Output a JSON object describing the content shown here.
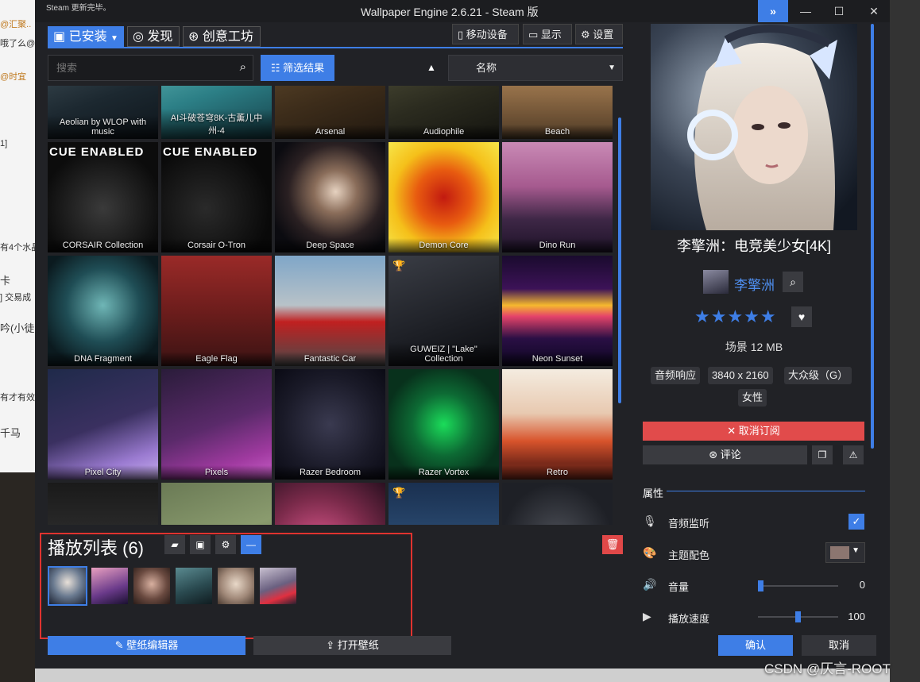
{
  "background": {
    "left_texts": [
      "@汇聚..",
      "哦了么@",
      "@时宜",
      "1]",
      "有4个水晶",
      "卡",
      "] 交易成",
      "吟(小徒",
      "有才有效",
      "千马"
    ]
  },
  "window": {
    "title": "Wallpaper Engine 2.6.21 - Steam 版",
    "steam_note": "Steam 更新完毕。",
    "controls": [
      "»",
      "—",
      "☐",
      "✕"
    ]
  },
  "tabs": [
    {
      "label": "已安装",
      "icon": "save-icon",
      "active": true
    },
    {
      "label": "发现",
      "icon": "compass-icon",
      "active": false
    },
    {
      "label": "创意工坊",
      "icon": "steam-icon",
      "active": false
    }
  ],
  "toolbar": {
    "mobile": "移动设备",
    "display": "显示",
    "settings": "设置"
  },
  "search": {
    "placeholder": "搜索"
  },
  "filter": {
    "label": "筛选结果"
  },
  "sort": {
    "direction": "▲",
    "value": "名称"
  },
  "wallpapers": [
    {
      "label": "Aeolian by WLOP with music",
      "bg": "linear-gradient(160deg,#4a5a62,#1c2830 60%,#0e151b)"
    },
    {
      "label": "AI斗破苍穹8K-古薰儿中州-4",
      "bg": "linear-gradient(160deg,#6fc3c0,#2c7f86 55%,#16414a)"
    },
    {
      "label": "Arsenal",
      "bg": "linear-gradient(160deg,#6a5131,#3c2c1a 60%,#221910)"
    },
    {
      "label": "Audiophile",
      "bg": "linear-gradient(160deg,#5a5a40,#2b2b1f 60%,#151510)"
    },
    {
      "label": "Beach",
      "bg": "linear-gradient(180deg,#d4a66a,#8d6a45 60%,#4f3a25)"
    },
    {
      "label": "CORSAIR Collection",
      "bg": "radial-gradient(circle at 50% 60%,#3a3a3a,#0c0c0c 70%)",
      "badge": "CUE ENABLED"
    },
    {
      "label": "Corsair O-Tron",
      "bg": "radial-gradient(circle at 40% 60%,#2a2a2a,#090909 70%)",
      "badge": "CUE ENABLED"
    },
    {
      "label": "Deep Space",
      "bg": "radial-gradient(ellipse at 55% 45%,#e6d2c0,#8a6d5a 25%,#2a2022 55%,#0b0b10 80%)"
    },
    {
      "label": "Demon Core",
      "bg": "radial-gradient(circle at 50% 50%,#c21a10,#e85b10 35%,#f5c01a 65%,#f7e64a)"
    },
    {
      "label": "Dino Run",
      "bg": "linear-gradient(180deg,#c98ab5,#a65a8f 40%,#3e2746 70%,#1d1228)"
    },
    {
      "label": "DNA Fragment",
      "bg": "radial-gradient(circle at 50% 45%,#6fb6b6,#1f4d55 45%,#0b1a1f 80%)"
    },
    {
      "label": "Eagle Flag",
      "bg": "linear-gradient(180deg,#9a2a28,#6d1d1c 50%,#3b1313)"
    },
    {
      "label": "Fantastic Car",
      "bg": "linear-gradient(180deg,#7fa6c8,#b8c2c8 45%,#c02020 60%,#4a4a4a)"
    },
    {
      "label": "GUWEIZ | \"Lake\" Collection",
      "bg": "linear-gradient(160deg,#3a3d45,#1d1f25 60%,#0b0c10)",
      "trophy": true
    },
    {
      "label": "Neon Sunset",
      "bg": "linear-gradient(180deg,#1a0b2e,#3c1257 30%,#f5b92e 45%,#e5436a 55%,#2a0f45 75%,#0d0620)"
    },
    {
      "label": "Pixel City",
      "bg": "linear-gradient(160deg,#1f2a4a,#3a3060 50%,#9a7ad0 80%,#c8b0f0)"
    },
    {
      "label": "Pixels",
      "bg": "linear-gradient(160deg,#2a1c3a,#5a2a6a 50%,#a03aa0 80%,#c860c8)"
    },
    {
      "label": "Razer Bedroom",
      "bg": "radial-gradient(circle at 50% 50%,#3a3a50,#1a1a28 60%,#0a0a14)"
    },
    {
      "label": "Razer Vortex",
      "bg": "radial-gradient(circle at 50% 50%,#1bdc5a,#0d6a34 40%,#08311c 75%)"
    },
    {
      "label": "Retro",
      "bg": "linear-gradient(180deg,#f4ece0,#e8c9b0 40%,#d8542c 65%,#7a2a1a 85%)"
    },
    {
      "label": "",
      "bg": "linear-gradient(180deg,#1a1a1a,#2c2c2c 50%,#0d0d0d)"
    },
    {
      "label": "",
      "bg": "linear-gradient(160deg,#6a7a55,#8a9b6e 50%,#4c5a3c)"
    },
    {
      "label": "",
      "bg": "radial-gradient(circle at 40% 60%,#e05a90,#7a2a4a 55%,#2a1020)"
    },
    {
      "label": "",
      "bg": "linear-gradient(180deg,#1a3050,#2a4a70 50%,#0e1c30)",
      "trophy": true
    },
    {
      "label": "",
      "bg": "radial-gradient(circle at 50% 50%,#4a4d55,#1e2026 70%)"
    }
  ],
  "playlist": {
    "title": "播放列表 (6)",
    "thumbs": [
      {
        "bg": "radial-gradient(circle at 50% 40%,#e8e0d8,#6a7a90 50%,#1a2030)",
        "selected": true
      },
      {
        "bg": "linear-gradient(160deg,#e8a0c0,#6a3a8a 60%,#1a1030)"
      },
      {
        "bg": "radial-gradient(circle at 50% 45%,#d8b0a0,#6a4a40 55%,#2a1c18)"
      },
      {
        "bg": "linear-gradient(160deg,#5a8a90,#2a4a50 55%,#101c20)"
      },
      {
        "bg": "radial-gradient(circle at 50% 45%,#e8d8c8,#a08878 55%,#4a3a30)"
      },
      {
        "bg": "linear-gradient(160deg,#c8c0d0,#6a6080 50%,#e03040 75%,#2a2030)"
      }
    ]
  },
  "bottom": {
    "editor": "壁纸编辑器",
    "open": "打开壁纸"
  },
  "details": {
    "title": "李擎洲：电竞美少女[4K]",
    "author": "李擎洲",
    "stars": "★★★★★",
    "meta": "场景 12 MB",
    "tags": [
      "音频响应",
      "3840 x 2160",
      "大众级（G）",
      "女性"
    ],
    "unsubscribe": "✕ 取消订阅",
    "comment": "评论",
    "properties_header": "属性",
    "audio_label": "音频监听",
    "color_label": "主题配色",
    "volume_label": "音量",
    "volume_value": "0",
    "speed_label": "播放速度",
    "speed_value": "100",
    "ok": "确认",
    "cancel": "取消",
    "audio_checked": true,
    "volume_level": 0,
    "speed_level": 0.5,
    "theme_color": "#8c7670"
  },
  "watermark": "CSDN @仄言-ROOT",
  "colors": {
    "accent": "#3e7ee6",
    "danger": "#e14b4b",
    "background": "#212226"
  }
}
